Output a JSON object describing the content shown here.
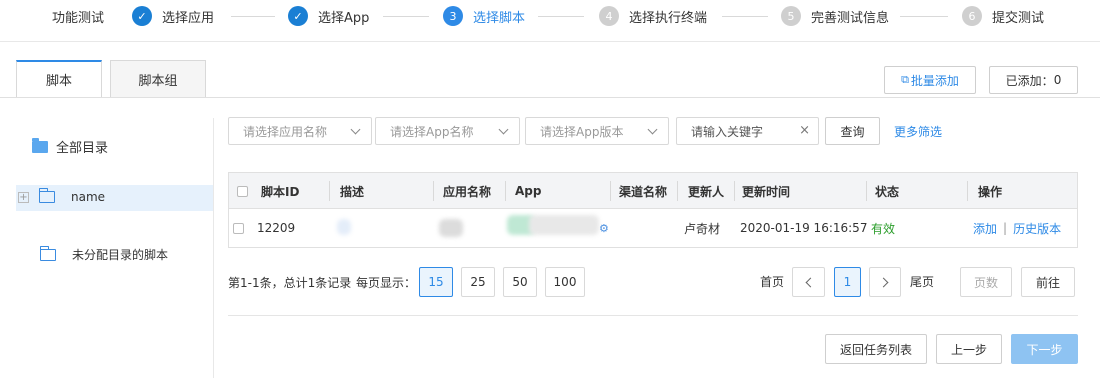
{
  "stepper": {
    "title": "功能测试",
    "steps": [
      {
        "num": "✓",
        "label": "选择应用",
        "state": "done"
      },
      {
        "num": "✓",
        "label": "选择App",
        "state": "done"
      },
      {
        "num": "3",
        "label": "选择脚本",
        "state": "active"
      },
      {
        "num": "4",
        "label": "选择执行终端",
        "state": "todo"
      },
      {
        "num": "5",
        "label": "完善测试信息",
        "state": "todo"
      },
      {
        "num": "6",
        "label": "提交测试",
        "state": "todo"
      }
    ]
  },
  "tabs": [
    {
      "label": "脚本",
      "active": true
    },
    {
      "label": "脚本组",
      "active": false
    }
  ],
  "toolbar": {
    "batch_add": "批量添加",
    "added_label": "已添加：",
    "added_count": "0"
  },
  "tree": {
    "root": "全部目录",
    "items": [
      {
        "label": "name",
        "selected": true
      },
      {
        "label": "未分配目录的脚本",
        "selected": false
      }
    ]
  },
  "filters": {
    "app_name_placeholder": "请选择应用名称",
    "app_placeholder": "请选择App名称",
    "version_placeholder": "请选择App版本",
    "keyword_placeholder": "请输入关键字",
    "clear": "×",
    "query": "查询",
    "more": "更多筛选"
  },
  "table": {
    "headers": [
      "脚本ID",
      "描述",
      "应用名称",
      "App",
      "渠道名称",
      "更新人",
      "更新时间",
      "状态",
      "操作"
    ],
    "rows": [
      {
        "id": "12209",
        "updater": "卢奇材",
        "time": "2020-01-19 16:16:57",
        "status": "有效",
        "action_add": "添加",
        "action_history": "历史版本",
        "action_sep": "|"
      }
    ]
  },
  "pagination": {
    "summary": "第1-1条，总计1条记录",
    "per_page_label": "每页显示：",
    "sizes": [
      "15",
      "25",
      "50",
      "100"
    ],
    "selected_size": "15",
    "first": "首页",
    "last": "尾页",
    "current_page": "1",
    "page_input_placeholder": "页数",
    "go": "前往"
  },
  "footer": {
    "back_to_list": "返回任务列表",
    "prev": "上一步",
    "next": "下一步"
  },
  "colors": {
    "accent": "#2e8ae6",
    "status_ok": "#2a9d2a"
  }
}
